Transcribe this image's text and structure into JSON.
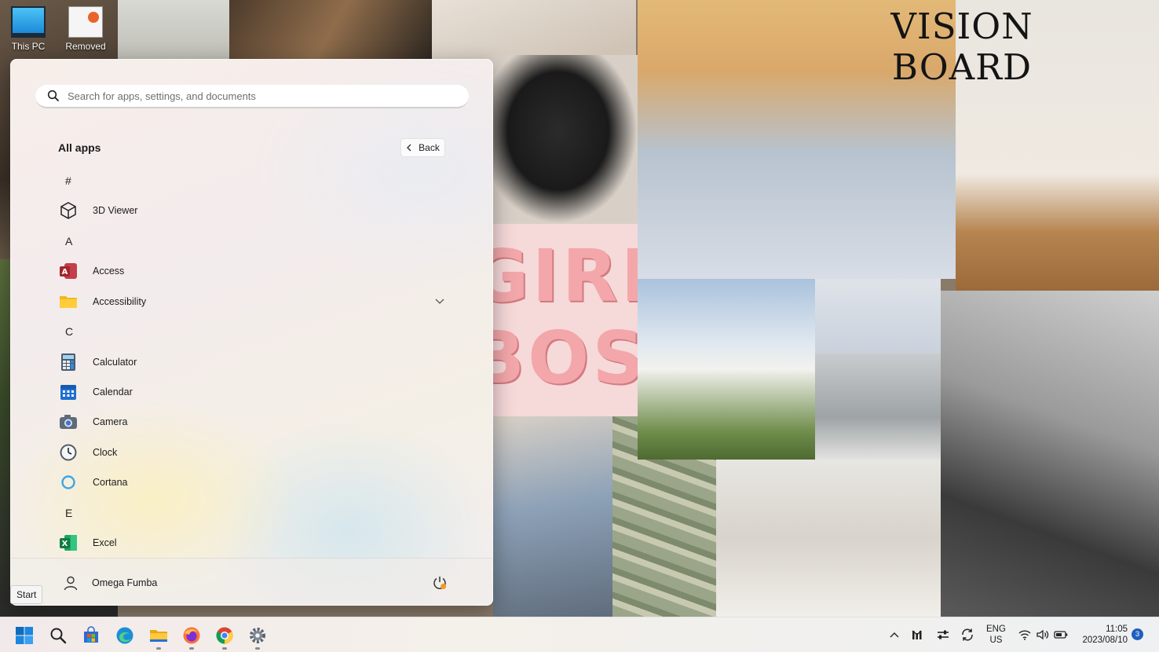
{
  "wallpaper": {
    "girl_line1": "GIRL",
    "girl_line2": "BOSS",
    "vision_line1": "VISION",
    "vision_line2": "BOARD"
  },
  "desktop": {
    "icons": [
      {
        "label": "This PC",
        "icon": "computer-icon"
      },
      {
        "label": "Removed",
        "icon": "document-icon"
      }
    ]
  },
  "start_menu": {
    "search_placeholder": "Search for apps, settings, and documents",
    "all_apps_title": "All apps",
    "back_label": "Back",
    "sections": [
      {
        "letter": "#",
        "apps": [
          {
            "label": "3D Viewer",
            "icon": "cube-icon"
          }
        ]
      },
      {
        "letter": "A",
        "apps": [
          {
            "label": "Access",
            "icon": "access-icon"
          },
          {
            "label": "Accessibility",
            "icon": "folder-icon",
            "expandable": true
          }
        ]
      },
      {
        "letter": "C",
        "apps": [
          {
            "label": "Calculator",
            "icon": "calculator-icon"
          },
          {
            "label": "Calendar",
            "icon": "calendar-icon"
          },
          {
            "label": "Camera",
            "icon": "camera-icon"
          },
          {
            "label": "Clock",
            "icon": "clock-icon"
          },
          {
            "label": "Cortana",
            "icon": "cortana-icon"
          }
        ]
      },
      {
        "letter": "E",
        "apps": [
          {
            "label": "Excel",
            "icon": "excel-icon"
          }
        ]
      }
    ],
    "user_name": "Omega Fumba"
  },
  "tooltip": {
    "text": "Start"
  },
  "taskbar": {
    "language_line1": "ENG",
    "language_line2": "US",
    "time": "11:05",
    "date": "2023/08/10",
    "notification_count": "3",
    "accent": "#0f6cbd"
  }
}
